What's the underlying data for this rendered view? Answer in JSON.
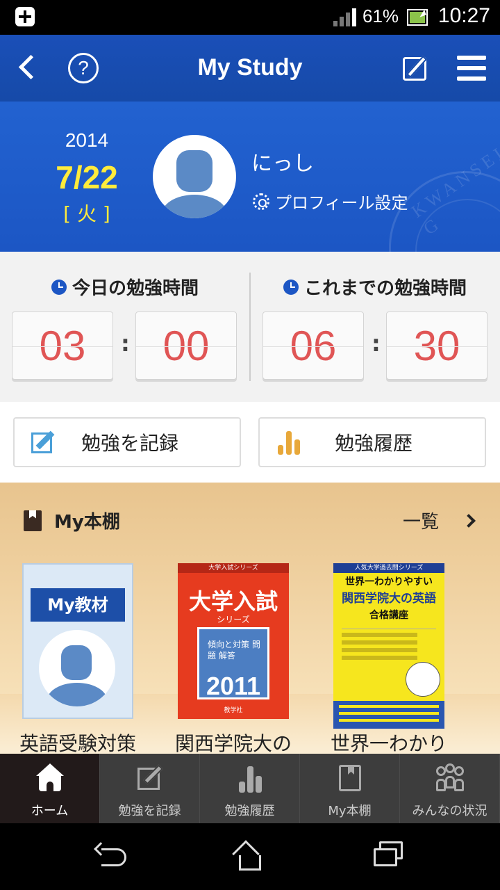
{
  "status_bar": {
    "battery": "61%",
    "time": "10:27"
  },
  "app_bar": {
    "title": "My Study",
    "help_glyph": "?"
  },
  "profile": {
    "year": "2014",
    "month_day": "7/22",
    "weekday": "[ 火 ]",
    "name": "にっし",
    "settings_link": "プロフィール設定",
    "watermark_text": "KWANSEI G"
  },
  "timers": {
    "today": {
      "label": "今日の勉強時間",
      "hours": "03",
      "minutes": "00"
    },
    "total": {
      "label": "これまでの勉強時間",
      "hours": "06",
      "minutes": "30"
    },
    "separator": ":",
    "digit_color": "#e05555"
  },
  "actions": {
    "record": {
      "label": "勉強を記録",
      "icon": "pencil-square-icon"
    },
    "history": {
      "label": "勉強履歴",
      "icon": "bar-chart-icon"
    }
  },
  "bookshelf": {
    "title": "My本棚",
    "more_label": "一覧",
    "books": [
      {
        "cover_tag": "My教材",
        "caption": "英語受験対策"
      },
      {
        "cover_series": "大学入試シリーズ",
        "cover_title": "大学入試",
        "cover_sub": "シリーズ",
        "cover_box": "傾向と対策 問題 解答",
        "cover_year": "2011",
        "cover_publisher": "教学社",
        "caption": "関西学院大の"
      },
      {
        "cover_series": "人気大学過去問シリーズ",
        "cover_line1": "世界一わかりやすい",
        "cover_line2": "関西学院大の英語",
        "cover_line3": "合格講座",
        "caption": "世界一わかり"
      }
    ]
  },
  "tab_bar": {
    "items": [
      {
        "label": "ホーム",
        "icon": "home-icon",
        "active": true
      },
      {
        "label": "勉強を記録",
        "icon": "pencil-square-icon",
        "active": false
      },
      {
        "label": "勉強履歴",
        "icon": "bar-chart-icon",
        "active": false
      },
      {
        "label": "My本棚",
        "icon": "book-icon",
        "active": false
      },
      {
        "label": "みんなの状況",
        "icon": "people-icon",
        "active": false
      }
    ]
  },
  "colors": {
    "app_bar": "#164aa8",
    "profile_bg": "#1c56c4",
    "date_highlight": "#ffeb3b",
    "tab_bar_bg": "#3d3d3d"
  }
}
